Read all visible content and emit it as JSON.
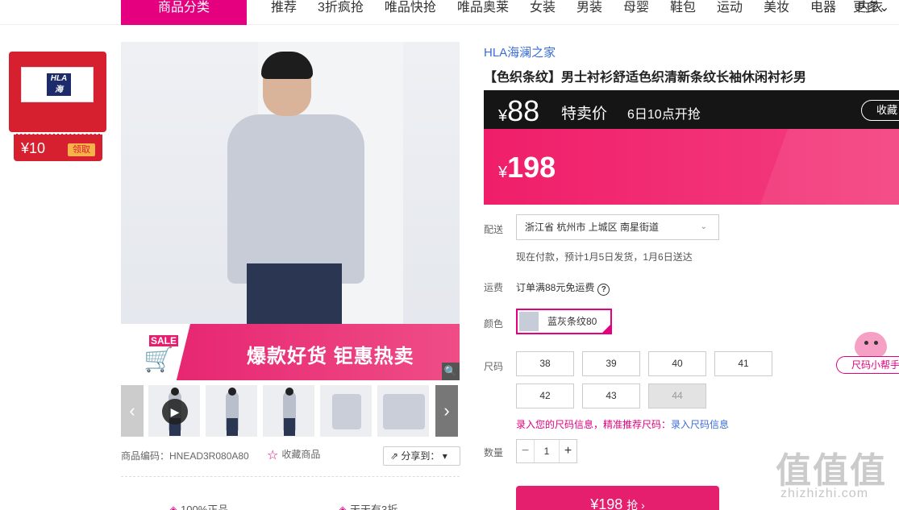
{
  "nav": {
    "category_button": "商品分类",
    "items": [
      "推荐",
      "3折疯抢",
      "唯品快抢",
      "唯品奥莱",
      "女装",
      "男装",
      "母婴",
      "鞋包",
      "运动",
      "美妆",
      "电器",
      "内衣"
    ],
    "more": "更多⌄"
  },
  "coupon": {
    "logo_text": "HLA 海澜之家",
    "amount": "¥10",
    "claim_label": "领取"
  },
  "gallery": {
    "banner_sale": "SALE",
    "banner_text": "爆款好货 钜惠热卖",
    "icons": {
      "zoom": "magnifier-icon",
      "play": "play-icon",
      "prev": "chevron-left-icon",
      "next": "chevron-right-icon"
    }
  },
  "product": {
    "sku_code": "商品编码：HNEAD3R080A80",
    "favorite_label": "收藏商品",
    "share_label": "分享到：",
    "guarantees": [
      "100%正品",
      "天天有3折"
    ],
    "brand": "HLA海澜之家",
    "title": "【色织条纹】男士衬衫舒适色织清新条纹长袖休闲衬衫男"
  },
  "price": {
    "sale_yen": "¥",
    "sale_value": "88",
    "sale_label": "特卖价",
    "sale_time": "6日10点开抢",
    "collect_label": "收藏",
    "orig_yen": "¥",
    "orig_value": "198"
  },
  "delivery": {
    "label": "配送",
    "address": "浙江省 杭州市 上城区 南星街道",
    "note": "现在付款，预计1月5日发货，1月6日送达"
  },
  "freight": {
    "label": "运费",
    "text": "订单满88元免运费"
  },
  "color": {
    "label": "颜色",
    "selected": "蓝灰条纹80"
  },
  "size": {
    "label": "尺码",
    "options": [
      "38",
      "39",
      "40",
      "41",
      "42",
      "43",
      "44"
    ],
    "disabled": [
      "44"
    ],
    "link_a": "录入您的尺码信息，精准推荐尺码：",
    "link_b": "录入尺码信息"
  },
  "quantity": {
    "label": "数量",
    "value": "1",
    "minus": "−",
    "plus": "+"
  },
  "buy": {
    "price": "¥198",
    "action": "抢 ›"
  },
  "helper": {
    "label": "尺码小帮手"
  },
  "watermark": {
    "text": "值值值",
    "url": "zhizhizhi.com"
  },
  "colors": {
    "accent": "#e4007f",
    "price_pink": "#f01e6a",
    "dark_bar": "#151515",
    "link_blue": "#3a6dd8"
  }
}
